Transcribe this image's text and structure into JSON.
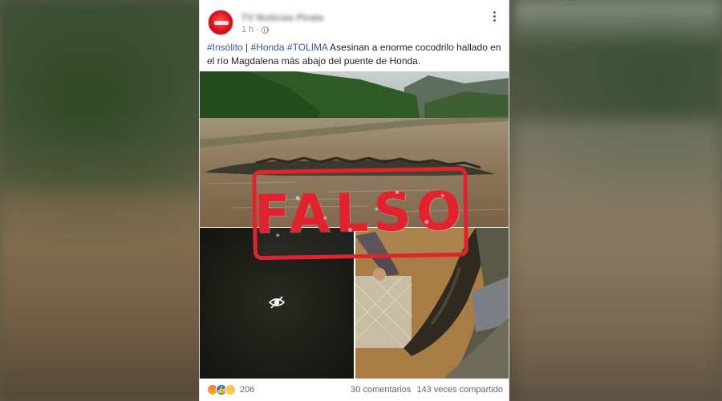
{
  "post": {
    "page_name": "TV Noticias Pirata",
    "timestamp": "1 h",
    "hashtags": [
      "#Insólito",
      "#Honda",
      "#TOLIMA"
    ],
    "separator": "|",
    "body_text": "Asesinan a enorme cocodrilo hallado en el río Magdalena más abajo del puente de Honda.",
    "stamp_text": "FALSO",
    "footer": {
      "reaction_count": "206",
      "comments": "30 comentarios",
      "shares": "143 veces compartido"
    }
  },
  "colors": {
    "stamp": "#e2232e",
    "hashtag": "#385898",
    "avatar": "#d6121b"
  },
  "icons": [
    "globe-icon",
    "more-options-icon",
    "eye-icon",
    "angry-reaction-icon",
    "like-reaction-icon",
    "wow-reaction-icon"
  ]
}
